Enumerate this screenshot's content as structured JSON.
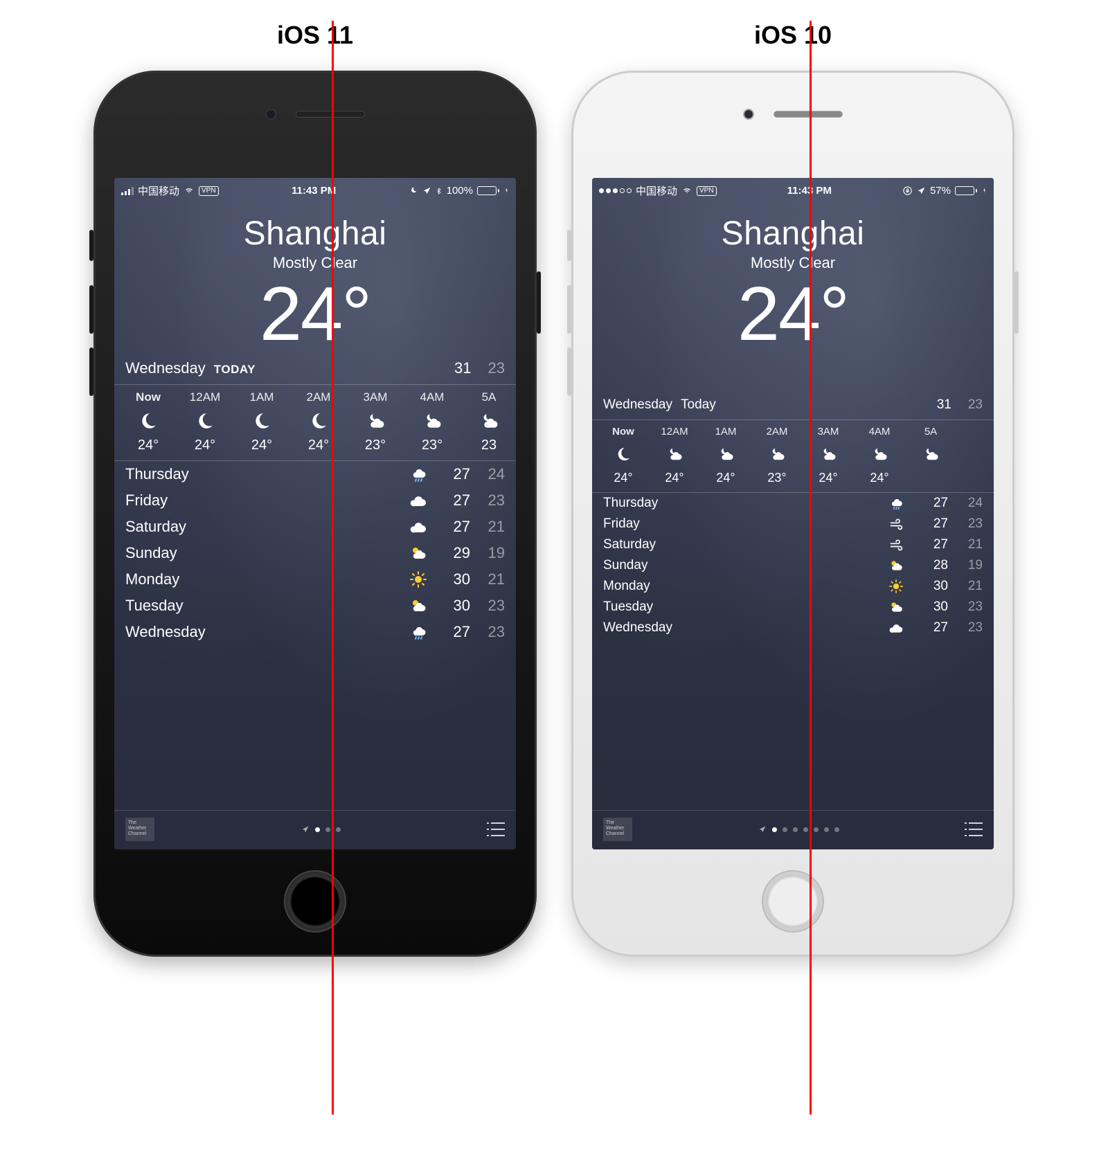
{
  "comparison": {
    "left_title": "iOS 11",
    "right_title": "iOS 10"
  },
  "left": {
    "status": {
      "carrier": "中国移动",
      "vpn": "VPN",
      "time": "11:43 PM",
      "battery_pct": "100%",
      "battery_level": 100,
      "signal": 3,
      "icons_right": [
        "moon",
        "nav",
        "bluetooth"
      ]
    },
    "weather": {
      "city": "Shanghai",
      "condition": "Mostly Clear",
      "temp": "24°",
      "today_day": "Wednesday",
      "today_label": "TODAY",
      "today_hi": "31",
      "today_lo": "23"
    },
    "hourly": [
      {
        "label": "Now",
        "icon": "moon",
        "temp": "24°"
      },
      {
        "label": "12AM",
        "icon": "moon",
        "temp": "24°"
      },
      {
        "label": "1AM",
        "icon": "moon",
        "temp": "24°"
      },
      {
        "label": "2AM",
        "icon": "moon",
        "temp": "24°"
      },
      {
        "label": "3AM",
        "icon": "cloud-night",
        "temp": "23°"
      },
      {
        "label": "4AM",
        "icon": "cloud-night",
        "temp": "23°"
      },
      {
        "label": "5A",
        "icon": "cloud-night",
        "temp": "23"
      }
    ],
    "daily": [
      {
        "day": "Thursday",
        "icon": "rain-cloud",
        "hi": "27",
        "lo": "24"
      },
      {
        "day": "Friday",
        "icon": "cloud",
        "hi": "27",
        "lo": "23"
      },
      {
        "day": "Saturday",
        "icon": "cloud",
        "hi": "27",
        "lo": "21"
      },
      {
        "day": "Sunday",
        "icon": "sun-cloud",
        "hi": "29",
        "lo": "19"
      },
      {
        "day": "Monday",
        "icon": "sun",
        "hi": "30",
        "lo": "21"
      },
      {
        "day": "Tuesday",
        "icon": "sun-cloud",
        "hi": "30",
        "lo": "23"
      },
      {
        "day": "Wednesday",
        "icon": "rain-cloud",
        "hi": "27",
        "lo": "23"
      }
    ],
    "twc": "The Weather Channel",
    "page_dots": 3
  },
  "right": {
    "status": {
      "carrier": "中国移动",
      "vpn": "VPN",
      "time": "11:43 PM",
      "battery_pct": "57%",
      "battery_level": 57,
      "signal": 3,
      "icons_right": [
        "lock",
        "nav"
      ]
    },
    "weather": {
      "city": "Shanghai",
      "condition": "Mostly Clear",
      "temp": "24°",
      "today_day": "Wednesday",
      "today_label": "Today",
      "today_hi": "31",
      "today_lo": "23"
    },
    "hourly": [
      {
        "label": "Now",
        "icon": "moon",
        "temp": "24°"
      },
      {
        "label": "12AM",
        "icon": "cloud-night",
        "temp": "24°"
      },
      {
        "label": "1AM",
        "icon": "cloud-night",
        "temp": "24°"
      },
      {
        "label": "2AM",
        "icon": "cloud-night",
        "temp": "23°"
      },
      {
        "label": "3AM",
        "icon": "cloud-night",
        "temp": "24°"
      },
      {
        "label": "4AM",
        "icon": "cloud-night",
        "temp": "24°"
      },
      {
        "label": "5A",
        "icon": "cloud-night",
        "temp": ""
      }
    ],
    "daily": [
      {
        "day": "Thursday",
        "icon": "rain-cloud",
        "hi": "27",
        "lo": "24"
      },
      {
        "day": "Friday",
        "icon": "wind",
        "hi": "27",
        "lo": "23"
      },
      {
        "day": "Saturday",
        "icon": "wind",
        "hi": "27",
        "lo": "21"
      },
      {
        "day": "Sunday",
        "icon": "sun-cloud",
        "hi": "28",
        "lo": "19"
      },
      {
        "day": "Monday",
        "icon": "sun",
        "hi": "30",
        "lo": "21"
      },
      {
        "day": "Tuesday",
        "icon": "sun-cloud",
        "hi": "30",
        "lo": "23"
      },
      {
        "day": "Wednesday",
        "icon": "cloud",
        "hi": "27",
        "lo": "23"
      }
    ],
    "twc": "The Weather Channel",
    "page_dots": 7
  }
}
